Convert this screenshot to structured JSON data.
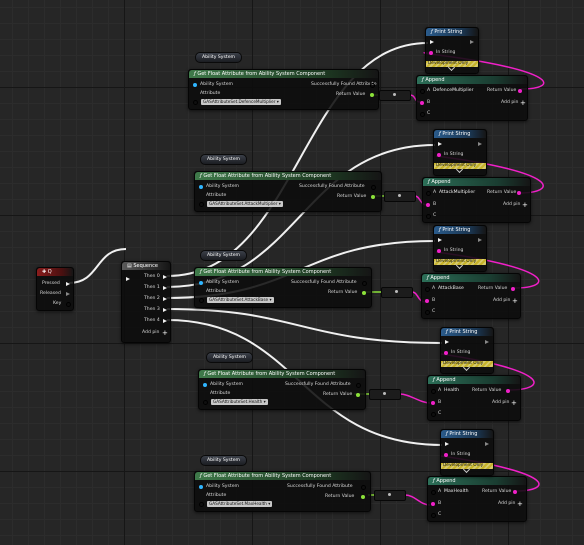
{
  "graph": {
    "pin_labels": {
      "target": "Ability System",
      "attribute": "Attribute",
      "found": "Successfully Found Attribute",
      "return_value": "Return Value",
      "in_string": "In String",
      "dev_only": "Development Only",
      "pin_a": "A",
      "pin_b": "B",
      "pin_c": "C",
      "add_pin": "Add pin"
    },
    "key_event": {
      "title": "Q",
      "pins": [
        "Pressed",
        "Released",
        "Key"
      ]
    },
    "sequence": {
      "title": "Sequence",
      "outputs": [
        "Then 0",
        "Then 1",
        "Then 2",
        "Then 3",
        "Then 4"
      ],
      "add_pin": "Add pin"
    },
    "get_attribute_nodes": [
      {
        "title": "Get Float Attribute from Ability System Component",
        "variable": "Ability System",
        "attribute": "GASAttributeSet.DefenceMultiplier"
      },
      {
        "title": "Get Float Attribute from Ability System Component",
        "variable": "Ability System",
        "attribute": "GASAttributeSet.AttackMultiplier"
      },
      {
        "title": "Get Float Attribute from Ability System Component",
        "variable": "Ability System",
        "attribute": "GASAttributeSet.AttackBase"
      },
      {
        "title": "Get Float Attribute from Ability System Component",
        "variable": "Ability System",
        "attribute": "GASAttributeSet.Health"
      },
      {
        "title": "Get Float Attribute from Ability System Component",
        "variable": "Ability System",
        "attribute": "GASAttributeSet.MaxHealth"
      }
    ],
    "append_nodes": [
      {
        "title": "Append",
        "a_value": "DefenceMultiplier"
      },
      {
        "title": "Append",
        "a_value": "AttackMultiplier"
      },
      {
        "title": "Append",
        "a_value": "AttackBase"
      },
      {
        "title": "Append",
        "a_value": "Health"
      },
      {
        "title": "Append",
        "a_value": "MaxHealth"
      }
    ],
    "print_nodes": [
      {
        "title": "Print String"
      },
      {
        "title": "Print String"
      },
      {
        "title": "Print String"
      },
      {
        "title": "Print String"
      },
      {
        "title": "Print String"
      }
    ],
    "colors": {
      "exec_wire": "#f0f0f0",
      "float_wire": "#8ce23a",
      "string_wire": "#f020c8",
      "object_pin": "#2fb5ff",
      "event_header": "#8a1c1c",
      "function_header": "#3f7a4a"
    }
  }
}
